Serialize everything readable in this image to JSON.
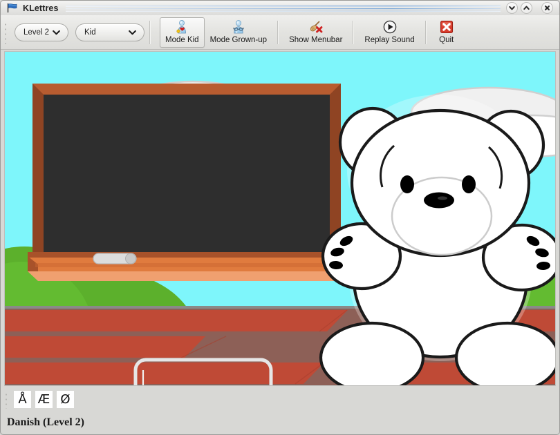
{
  "window": {
    "title": "KLettres",
    "app_icon": "flag-icon",
    "controls": {
      "minimize": {
        "name": "minimize-button",
        "icon": "chevron-down-icon"
      },
      "maximize": {
        "name": "maximize-button",
        "icon": "chevron-up-icon"
      },
      "close": {
        "name": "close-button",
        "icon": "close-x-icon"
      }
    }
  },
  "toolbar": {
    "level_combo": {
      "value": "Level 2",
      "icon": "chevron-down-icon"
    },
    "mode_combo": {
      "value": "Kid",
      "icon": "chevron-down-icon"
    },
    "buttons": [
      {
        "label": "Mode Kid",
        "icon": "child-avatar-icon",
        "active": true
      },
      {
        "label": "Mode Grown-up",
        "icon": "adult-avatar-icon",
        "active": false
      },
      {
        "label": "Show Menubar",
        "icon": "broom-remove-icon",
        "active": false
      },
      {
        "label": "Replay Sound",
        "icon": "play-circle-icon",
        "active": false
      },
      {
        "label": "Quit",
        "icon": "quit-x-icon",
        "active": false
      }
    ]
  },
  "scene": {
    "description": "Classroom outdoor scene with blackboard, teddy bear and brick wall",
    "blackboard_text": "",
    "answer_field_value": "",
    "chalk": "chalk-piece",
    "colors": {
      "sky": "#7ef6fb",
      "cloud": "#f0f0f0",
      "cloud_outline": "#cfcfcf",
      "grass_light": "#7ec93a",
      "bush_dark": "#5cb02c",
      "board_frame": "#a8522a",
      "board_frame_light": "#b85c30",
      "board_surface": "#2e2e2e",
      "ledge": "#e07b3e",
      "ledge_light": "#f0a070",
      "brick": "#bf4a36",
      "brick_mortar": "#8d6057",
      "bear_body": "#ffffff",
      "bear_outline": "#1a1a1a",
      "input_border": "#e6e6e6"
    }
  },
  "charbar": {
    "buttons": [
      {
        "label": "Å",
        "name": "special-char-a-ring"
      },
      {
        "label": "Æ",
        "name": "special-char-ae"
      },
      {
        "label": "Ø",
        "name": "special-char-o-slash"
      }
    ]
  },
  "statusbar": {
    "text": "Danish  (Level 2)"
  }
}
